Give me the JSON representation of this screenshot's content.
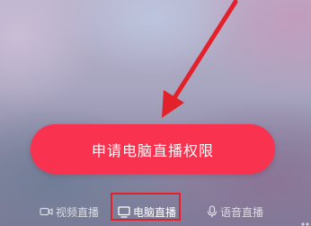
{
  "apply_button": {
    "label": "申请电脑直播权限",
    "color": "#f8324f"
  },
  "annotations": {
    "arrow_color": "#e3212b",
    "highlight_color": "#e3212b"
  },
  "mode_tabs": [
    {
      "label": "视频直播",
      "icon": "video-camera-icon",
      "active": false
    },
    {
      "label": "电脑直播",
      "icon": "monitor-icon",
      "active": true
    },
    {
      "label": "语音直播",
      "icon": "microphone-icon",
      "active": false
    }
  ]
}
